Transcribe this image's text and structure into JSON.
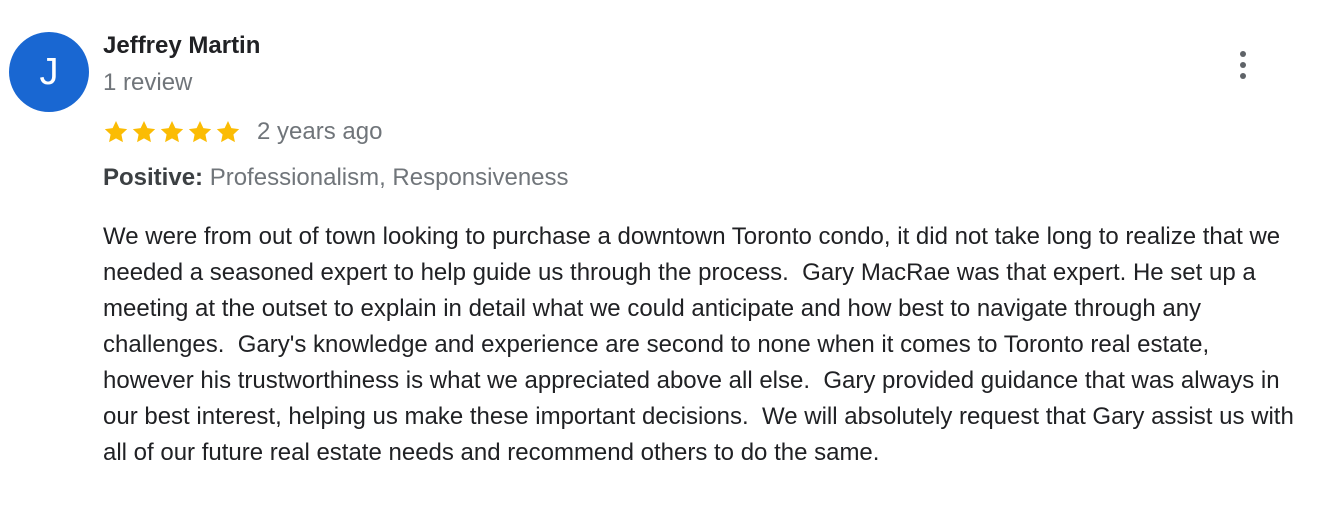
{
  "reviewer": {
    "initial": "J",
    "name": "Jeffrey Martin",
    "review_count": "1 review",
    "avatar_color": "#1967d2"
  },
  "rating": {
    "stars": 5,
    "max_stars": 5,
    "star_color": "#fbbc04",
    "star_icon": "star-icon"
  },
  "review": {
    "date": "2 years ago",
    "highlights_label": "Positive:",
    "highlights_value": "Professionalism, Responsiveness",
    "text": "We were from out of town looking to purchase a downtown Toronto condo, it did not take long to realize that we needed a seasoned expert to help guide us through the process.  Gary MacRae was that expert. He set up a meeting at the outset to explain in detail what we could anticipate and how best to navigate through any challenges.  Gary's knowledge and experience are second to none when it comes to Toronto real estate, however his trustworthiness is what we appreciated above all else.  Gary provided guidance that was always in our best interest, helping us make these important decisions.  We will absolutely request that Gary assist us with all of our future real estate needs and recommend others to do the same."
  },
  "actions": {
    "more_icon": "more-vert-icon"
  }
}
